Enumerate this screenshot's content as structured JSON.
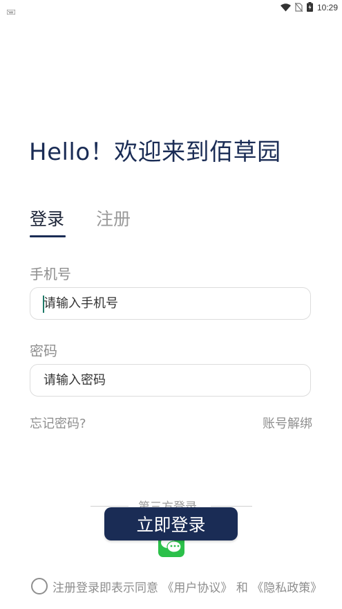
{
  "status_bar": {
    "time": "10:29",
    "icons": [
      "keyboard-icon",
      "wifi-icon",
      "no-sim-icon",
      "battery-charging-icon"
    ]
  },
  "welcome": {
    "title": "Hello！欢迎来到佰草园"
  },
  "tabs": {
    "login": "登录",
    "register": "注册",
    "active": "login"
  },
  "form": {
    "phone_label": "手机号",
    "phone_placeholder": "请输入手机号",
    "password_label": "密码",
    "password_placeholder": "请输入密码"
  },
  "links": {
    "forgot_password": "忘记密码?",
    "unbind_account": "账号解绑"
  },
  "third_party": {
    "label": "第三方登录",
    "providers": [
      "wechat-icon"
    ]
  },
  "login_button": {
    "label": "立即登录"
  },
  "agreement": {
    "prefix": "注册登录即表示同意",
    "user_agreement": "《用户协议》",
    "connector": "和",
    "privacy_policy": "《隐私政策》",
    "checked": false
  },
  "colors": {
    "primary": "#1a2c55",
    "muted_text": "#8e8e8e",
    "wechat_green": "#2cc04a",
    "caret": "#1e7a68"
  }
}
